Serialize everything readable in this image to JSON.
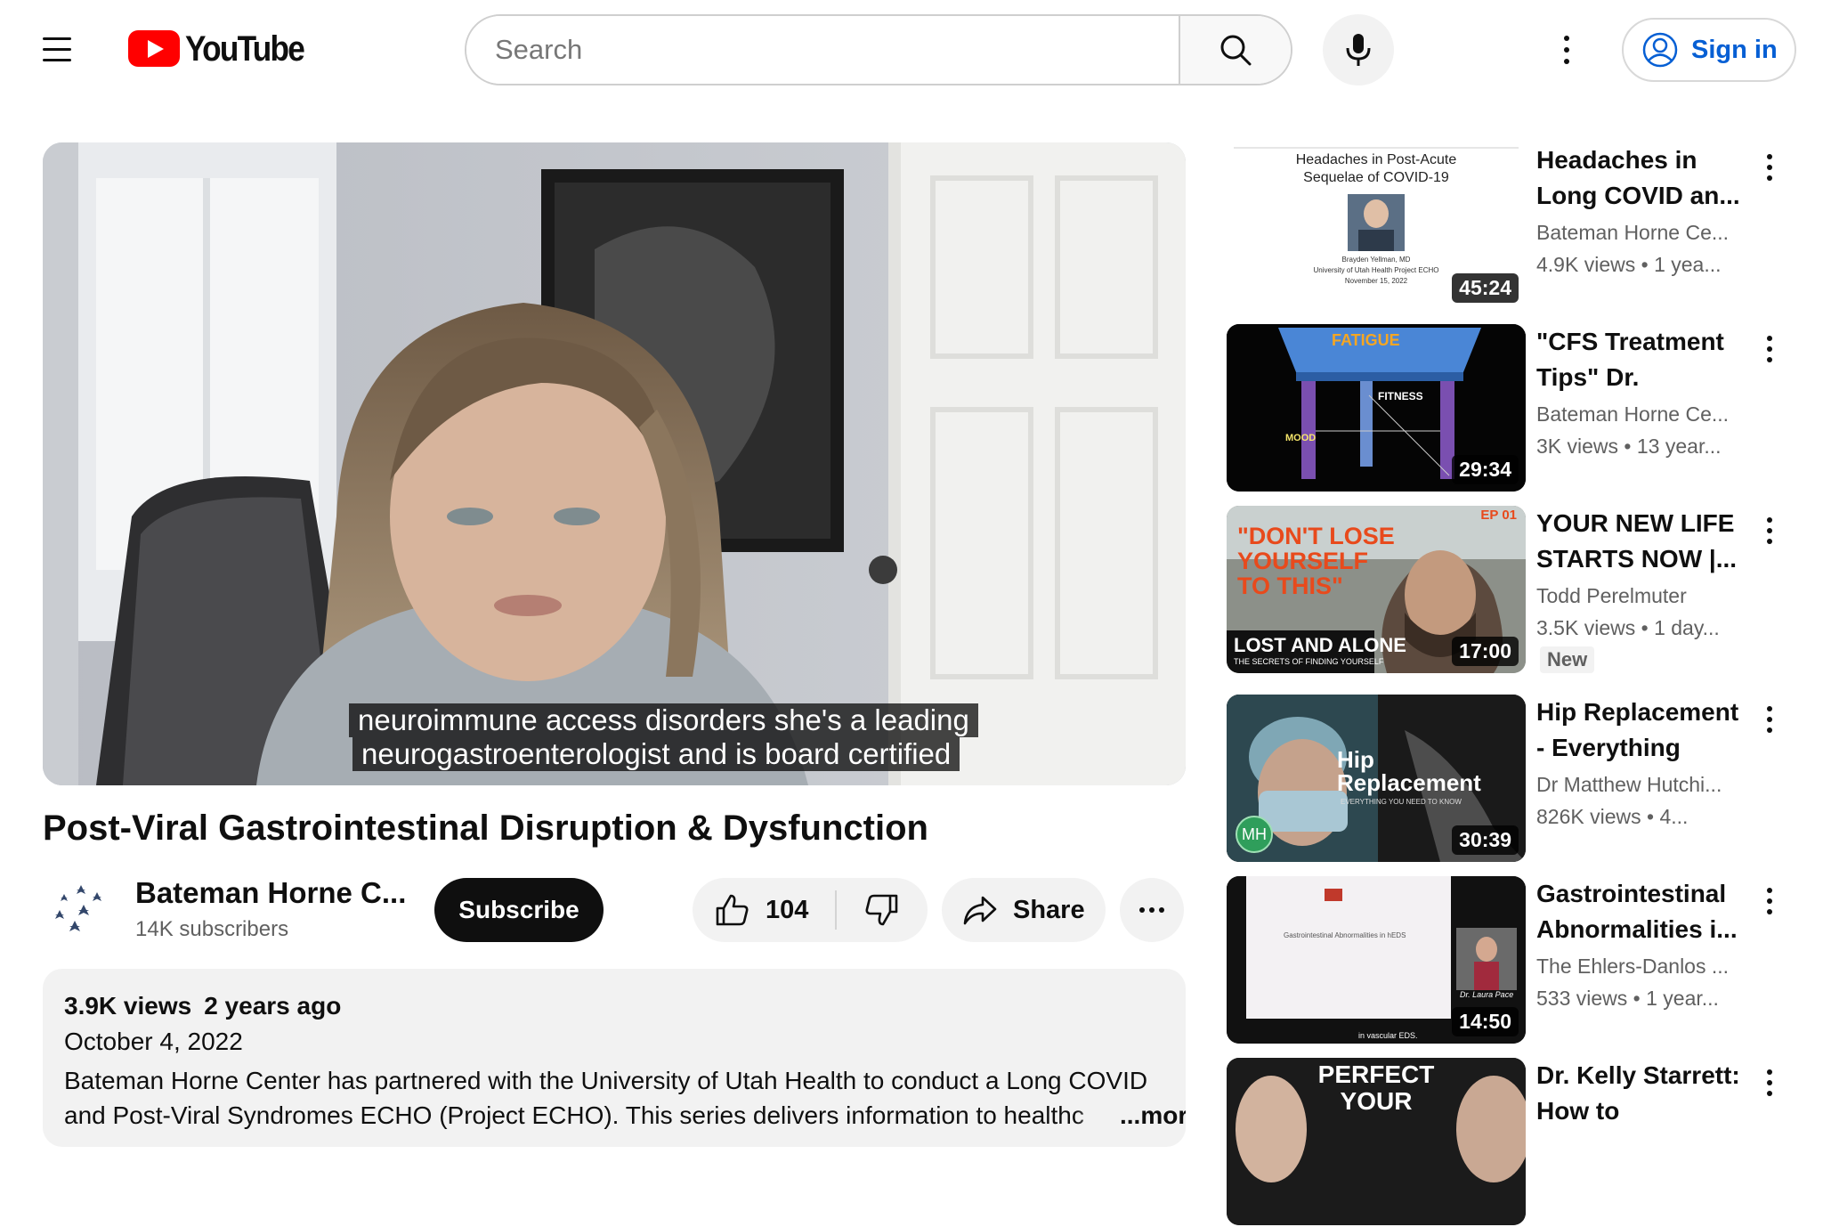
{
  "header": {
    "logo_text": "YouTube",
    "search_placeholder": "Search",
    "sign_in_label": "Sign in"
  },
  "player": {
    "caption_line1": "neuroimmune access disorders she's a leading",
    "caption_line2": "neurogastroenterologist and is board certified"
  },
  "video": {
    "title": "Post-Viral Gastrointestinal Disruption & Dysfunction",
    "channel_name": "Bateman Horne C...",
    "subscribers": "14K subscribers",
    "subscribe_label": "Subscribe",
    "likes": "104",
    "share_label": "Share"
  },
  "description": {
    "views": "3.9K views",
    "age": "2 years ago",
    "date": "October 4, 2022",
    "text": "Bateman Horne Center has partnered with the University of Utah Health to conduct a Long COVID and Post-Viral Syndromes ECHO (Project ECHO). This series delivers information to healthc",
    "more_label": "...more"
  },
  "sidebar": {
    "items": [
      {
        "title": "Headaches in Long COVID an...",
        "channel": "Bateman Horne Ce...",
        "views": "4.9K views",
        "age": "1 yea...",
        "duration": "45:24",
        "thumb_text_1": "Headaches in Post-Acute",
        "thumb_text_2": "Sequelae of COVID-19",
        "thumb_text_3": "Brayden Yellman, MD",
        "thumb_text_4": "University of Utah Health Project ECHO",
        "thumb_text_5": "November 15, 2022"
      },
      {
        "title": "\"CFS Treatment Tips\" Dr. Lucind...",
        "channel": "Bateman Horne Ce...",
        "views": "3K views",
        "age": "13 year...",
        "duration": "29:34",
        "thumb_text_1": "FATIGUE",
        "thumb_text_2": "FITNESS",
        "thumb_text_3": "MOOD"
      },
      {
        "title": "YOUR NEW LIFE STARTS NOW |...",
        "channel": "Todd Perelmuter",
        "views": "3.5K views",
        "age": "1 day...",
        "duration": "17:00",
        "badge": "New",
        "thumb_text_1": "EP 01",
        "thumb_text_2": "\"DON'T LOSE",
        "thumb_text_3": "YOURSELF",
        "thumb_text_4": "TO THIS\"",
        "thumb_text_5": "LOST AND ALONE",
        "thumb_text_6": "THE SECRETS OF FINDING YOURSELF"
      },
      {
        "title": "Hip Replacement - Everything you...",
        "channel": "Dr Matthew Hutchi...",
        "views": "826K views",
        "age": "4...",
        "duration": "30:39",
        "thumb_text_1": "Hip",
        "thumb_text_2": "Replacement",
        "thumb_text_3": "EVERYTHING YOU NEED TO KNOW",
        "thumb_text_4": "MH"
      },
      {
        "title": "Gastrointestinal Abnormalities i...",
        "channel": "The Ehlers-Danlos ...",
        "views": "533 views",
        "age": "1 year...",
        "duration": "14:50",
        "thumb_text_1": "Gastrointestinal Abnormalities in hEDS",
        "thumb_text_2": "Dr. Laura Pace",
        "thumb_text_3": "in vascular EDS."
      },
      {
        "title": "Dr. Kelly Starrett: How to Improve...",
        "thumb_text_1": "PERFECT",
        "thumb_text_2": "YOUR"
      }
    ]
  }
}
